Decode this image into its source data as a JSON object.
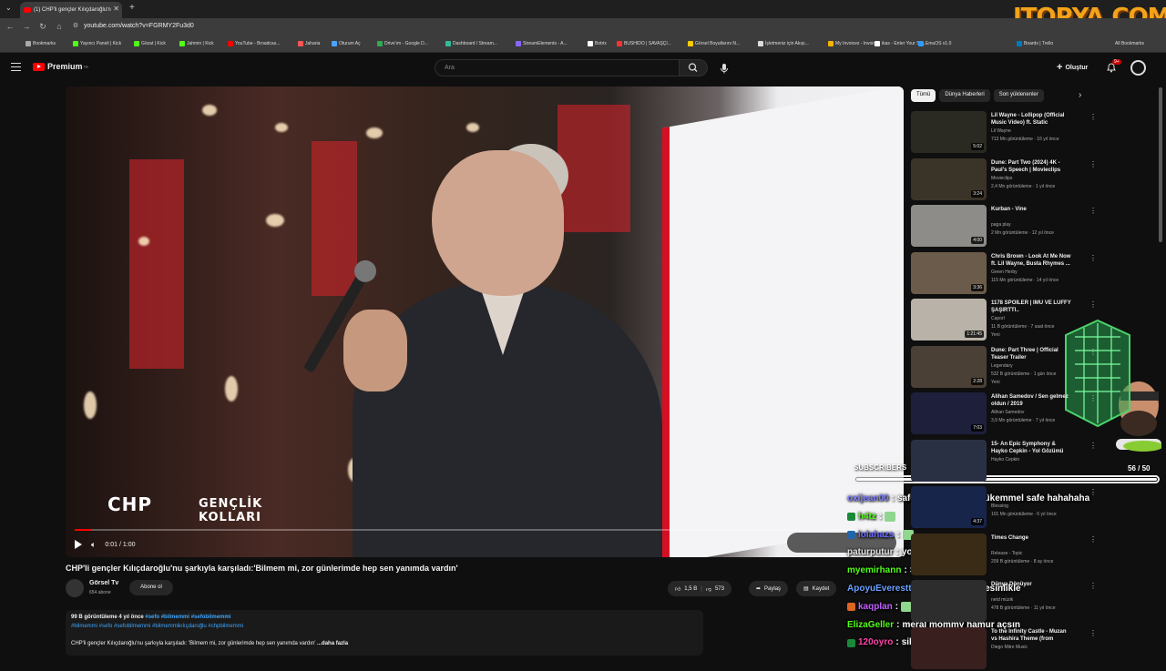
{
  "browser": {
    "tab_title": "(1) CHP'li gençler Kılıçdaroğlu'n",
    "url": "youtube.com/watch?v=FGRMY2Fu3d0",
    "bookmarks": [
      {
        "label": "Bookmarks",
        "color": "#aaaaaa"
      },
      {
        "label": "Yayıncı Paneli | Kick",
        "color": "#53fc18"
      },
      {
        "label": "Gözat | Kick",
        "color": "#53fc18"
      },
      {
        "label": "Jahmin | Kick",
        "color": "#53fc18"
      },
      {
        "label": "YouTube - Broadcas...",
        "color": "#ff0000"
      },
      {
        "label": "Jaharia",
        "color": "#ff5555"
      },
      {
        "label": "Oturum Aç",
        "color": "#4aa3ff"
      },
      {
        "label": "Drive'ım - Google D...",
        "color": "#34a853"
      },
      {
        "label": "Dashboard / Stream...",
        "color": "#33bb99"
      },
      {
        "label": "StreamElements - A...",
        "color": "#8866ff"
      },
      {
        "label": "Botrix",
        "color": "#ffffff"
      },
      {
        "label": "BUSHIDO | SAVAŞÇI...",
        "color": "#ff3333"
      },
      {
        "label": "Görsel Boyutlarını N...",
        "color": "#ffcc00"
      },
      {
        "label": "İşletmeniz için Akışı...",
        "color": "#dddddd"
      },
      {
        "label": "My Invoices - Invoic...",
        "color": "#f4b400"
      },
      {
        "label": "ikas - Enter Your Sto...",
        "color": "#ffffff"
      },
      {
        "label": "EmuOS v1.0",
        "color": "#3399ff"
      },
      {
        "label": "Boards | Trello",
        "color": "#0079bf"
      }
    ],
    "all_bookmarks": "All Bookmarks"
  },
  "watermark": "ITOPYA.COM",
  "youtube": {
    "logo_label": "Premium",
    "logo_sup": "TR",
    "search_placeholder": "Ara",
    "create_label": "Oluştur",
    "notif_count": "9+"
  },
  "video": {
    "title": "CHP'li gençler Kılıçdaroğlu'nu şarkıyla karşıladı:'Bilmem mi, zor günlerimde hep sen yanımda vardın'",
    "time": "0:01 / 1:00",
    "progress": 0.02,
    "overlay_logo": "CHP",
    "overlay_sub1": "GENÇLİK",
    "overlay_sub2": "KOLLARI",
    "channel": "Görsel Tv",
    "channel_subs": "654 abone",
    "subscribe": "Abone ol",
    "likes": "1,5 B",
    "dislikes": "573",
    "share": "Paylaş",
    "save": "Kaydet",
    "desc_meta": "99 B görüntüleme  4 yıl önce",
    "desc_tags1": "#sefo #bilmemmi #sefobilmemmi",
    "desc_tags2": "#bilmemmi #sefo #sefobilmemmi #bilmemmikılıçdaroğlu #chpbilmemmi",
    "desc_text": "CHP'li gençler Kılıçdaroğlu'nu şarkıyla karşıladı: 'Bilmem mi, zor günlerimde hep sen yanımda vardın'",
    "desc_more": "...daha fazla"
  },
  "chips": [
    "Tümü",
    "Dünya Haberleri",
    "Son yüklenenler"
  ],
  "recs": [
    {
      "title": "Lil Wayne - Lollipop (Official Music Video) ft. Static",
      "channel": "Lil Wayne",
      "meta": "713 Mn görüntüleme · 16 yıl önce",
      "dur": "5:02",
      "color": "#2b2a22"
    },
    {
      "title": "Dune: Part Two (2024) 4K - Paul's Speech | Movieclips",
      "channel": "Movieclips",
      "meta": "2,4 Mn görüntüleme · 1 yıl önce",
      "dur": "3:24",
      "color": "#3a3327"
    },
    {
      "title": "Kurban - Vine",
      "channel": "paga play",
      "meta": "2 Mn görüntüleme · 12 yıl önce",
      "dur": "4:00",
      "color": "#8e8c88"
    },
    {
      "title": "Chris Brown - Look At Me Now ft. Lil Wayne, Busta Rhymes ...",
      "channel": "Green Herby",
      "meta": "115 Mn görüntüleme · 14 yıl önce",
      "dur": "3:36",
      "color": "#6b5b4a"
    },
    {
      "title": "1178 SPOILER | IMU VE LUFFY ŞAŞIRTTI..",
      "channel": "Caporl",
      "meta": "11 B görüntüleme · 7 saat önce",
      "dur": "1:21:45",
      "color": "#b8b2a8",
      "badge": "Yeni"
    },
    {
      "title": "Dune: Part Three | Official Teaser Trailer",
      "channel": "Legendary",
      "meta": "532 B görüntüleme · 1 gün önce",
      "dur": "2:28",
      "color": "#4a4036",
      "badge": "Yeni"
    },
    {
      "title": "Alihan Samedov / Sen gelmez oldun / 2019",
      "channel": "Alihan Samedov",
      "meta": "3,9 Mn görüntüleme · 7 yıl önce",
      "dur": "7:03",
      "color": "#1d1f3b"
    },
    {
      "title": "15- An Epic Symphony & Hayko Cepkin - Yol Gözümü Dağlıyor",
      "channel": "Hayko Cepkin",
      "meta": "",
      "dur": "",
      "color": "#2a3044"
    },
    {
      "title": "",
      "channel": "Blessing",
      "meta": "101 Mn görüntüleme · 6 yıl önce",
      "dur": "4:37",
      "color": "#18254a"
    },
    {
      "title": "Times Change",
      "channel": "Release - Topic",
      "meta": "209 B görüntüleme · 8 ay önce",
      "dur": "",
      "color": "#3a2b16"
    },
    {
      "title": "Dünya Dönüyor",
      "channel": "netd müzik",
      "meta": "478 B görüntüleme · 11 yıl önce",
      "dur": "",
      "color": "#2d2d2d"
    },
    {
      "title": "To the Infinity Castle - Muzan vs Hashira Theme (from \"Demon ...",
      "channel": "Diego Mitre Music",
      "meta": "",
      "dur": "",
      "color": "#3a1f1f"
    }
  ],
  "overlay": {
    "sub_label": "SUBSCRIBERS",
    "sub_count": "56   / 50",
    "sub_progress": 1.0,
    "chat": [
      {
        "user": "oxijean00",
        "color": "#7f7fff",
        "text": "safe aynen kingo, mükemmel safe hahahaha",
        "badge": ""
      },
      {
        "user": "h4tz",
        "color": "#53fc18",
        "text": "",
        "badge": "#1a8a3a"
      },
      {
        "user": "lolahazs",
        "color": "#6a6aff",
        "text": "",
        "badge": "#2266aa"
      },
      {
        "user": "paturputur",
        "color": "#e0e0e0",
        "text": "yok",
        "badge": ""
      },
      {
        "user": "myemirhann",
        "color": "#53fc18",
        "text": "SEN VARDIN",
        "badge": ""
      },
      {
        "user": "ApoyuEverestteNYuvarlayan",
        "color": "#6aa0ff",
        "text": "kesinlikle",
        "badge": ""
      },
      {
        "user": "kaqplan",
        "color": "#c060ff",
        "text": "",
        "badge": "#dd6622"
      },
      {
        "user": "ElizaGeller",
        "color": "#53fc18",
        "text": "meral mommy hamur açsın",
        "badge": ""
      },
      {
        "user": "120oyro",
        "color": "#ff44aa",
        "text": "sikerler",
        "badge": "#1a8a3a"
      }
    ]
  }
}
